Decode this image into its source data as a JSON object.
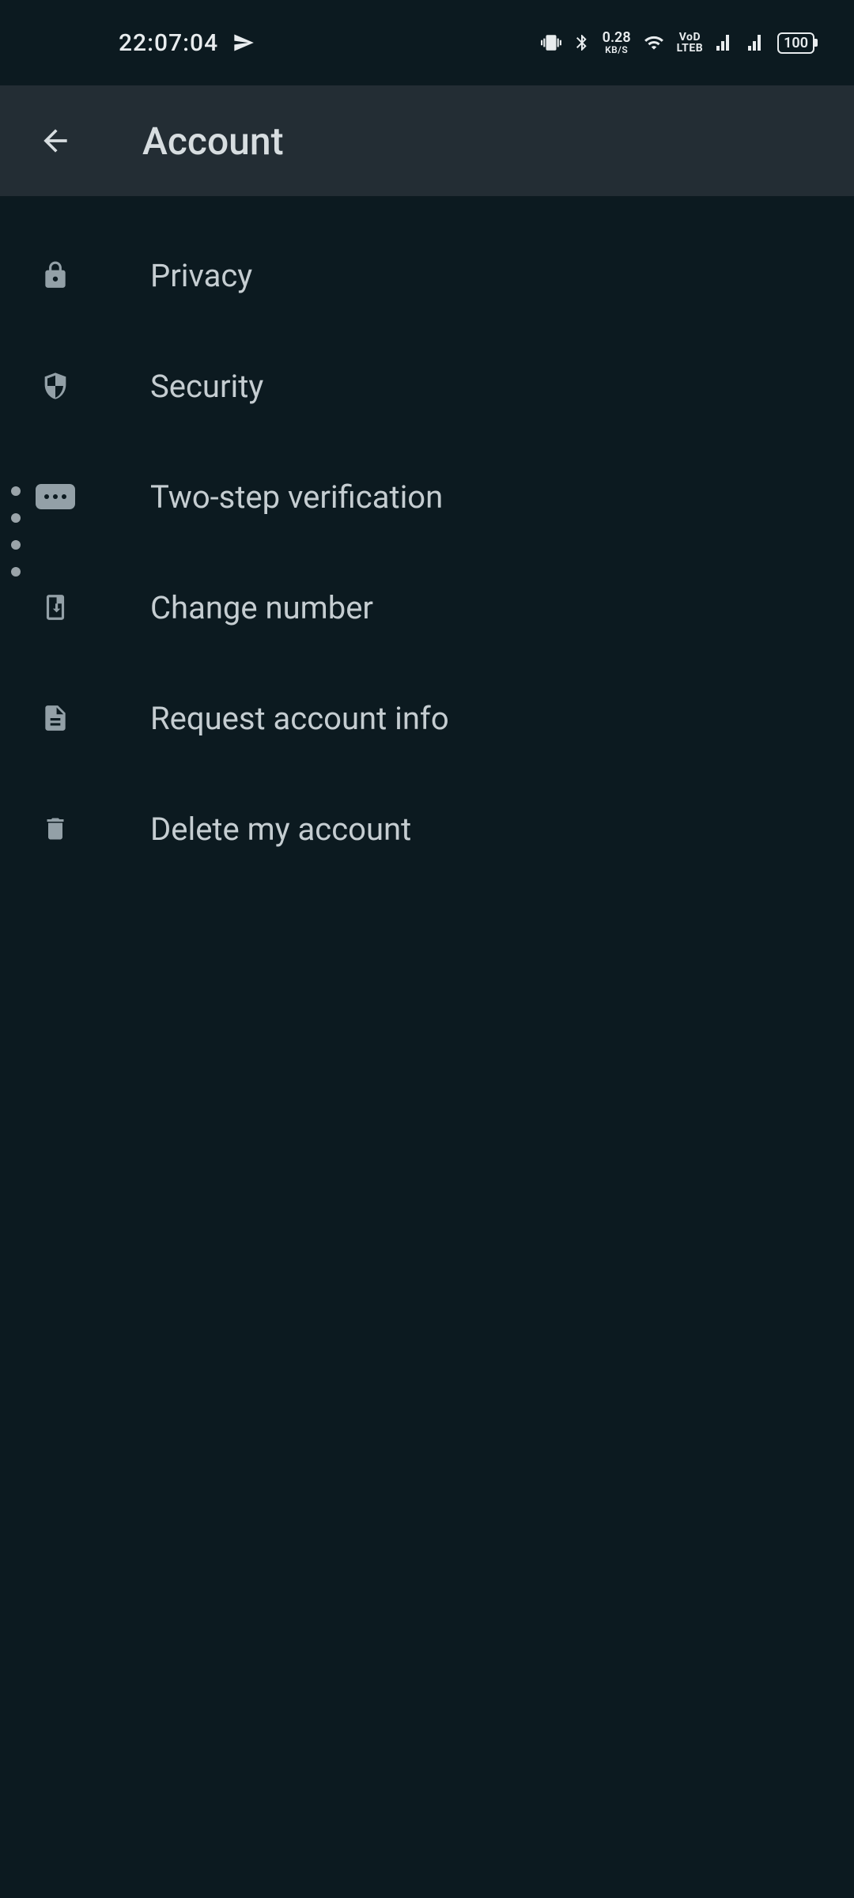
{
  "status": {
    "time": "22:07:04",
    "data_rate": "0.28",
    "data_unit": "KB/S",
    "vod_top": "VoD",
    "vod_bot": "LTEB",
    "battery": "100"
  },
  "header": {
    "title": "Account"
  },
  "menu": [
    {
      "icon": "lock-icon",
      "label": "Privacy"
    },
    {
      "icon": "shield-icon",
      "label": "Security"
    },
    {
      "icon": "pin-icon",
      "label": "Two-step verification"
    },
    {
      "icon": "sim-icon",
      "label": "Change number"
    },
    {
      "icon": "document-icon",
      "label": "Request account info"
    },
    {
      "icon": "trash-icon",
      "label": "Delete my account"
    }
  ]
}
